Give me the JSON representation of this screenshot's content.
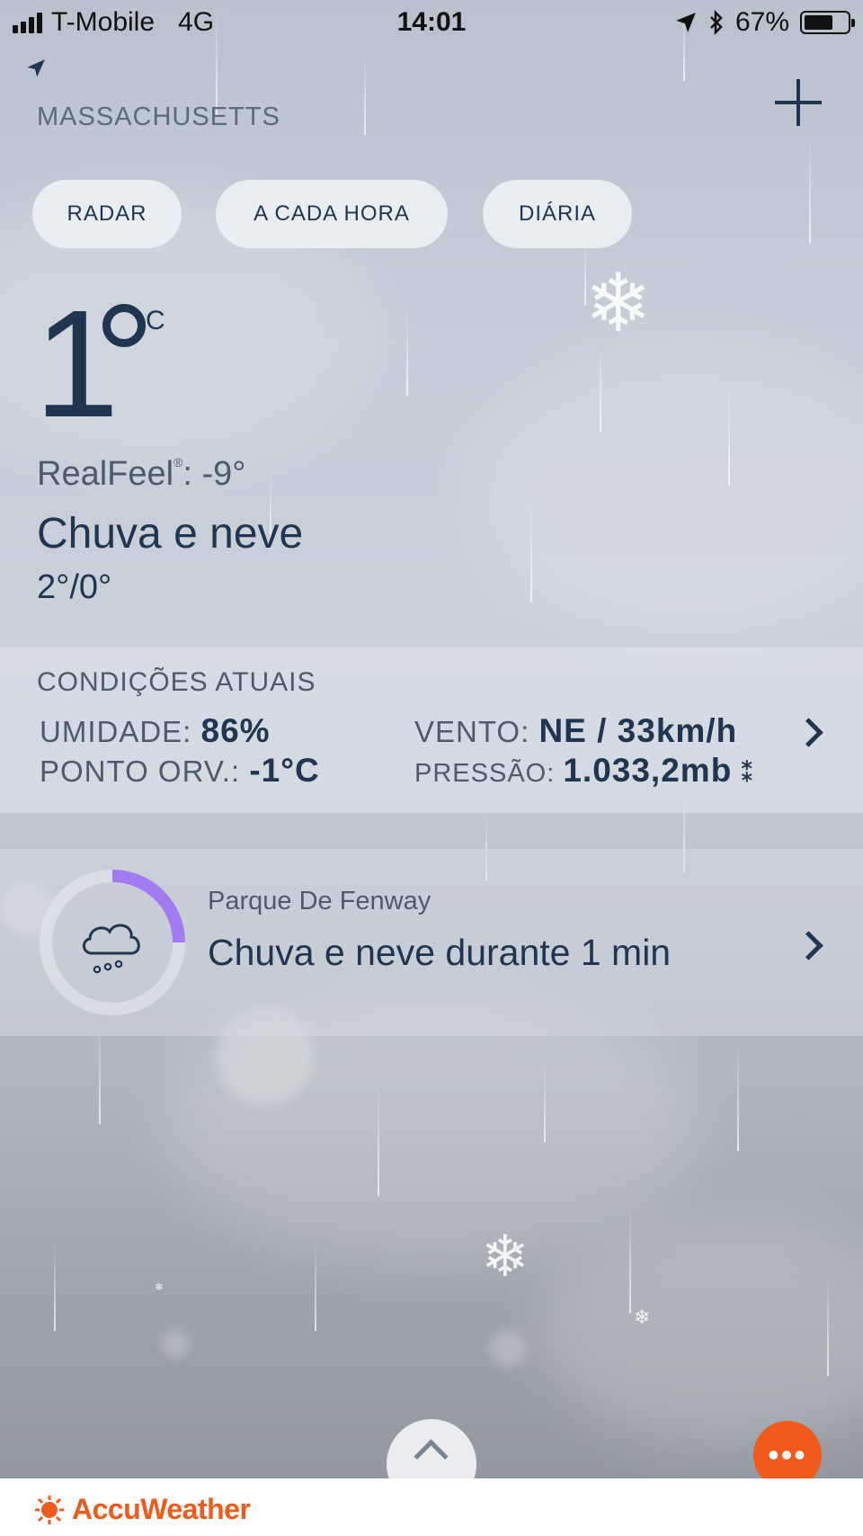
{
  "status_bar": {
    "carrier": "T-Mobile",
    "network": "4G",
    "time": "14:01",
    "battery_percent": "67%",
    "battery_level": 0.67
  },
  "header": {
    "region": "MASSACHUSETTS",
    "add_icon": "plus-icon",
    "location_icon": "location-arrow-icon"
  },
  "tabs": [
    {
      "label": "RADAR"
    },
    {
      "label": "A CADA HORA"
    },
    {
      "label": "DIÁRIA"
    }
  ],
  "current": {
    "temperature": "1",
    "unit": "C",
    "realfeel_label": "RealFeel",
    "realfeel_mark": "®",
    "realfeel_value": ": -9°",
    "condition": "Chuva e neve",
    "hi_lo": "2°/0°"
  },
  "conditions": {
    "title": "CONDIÇÕES ATUAIS",
    "humidity_label": "UMIDADE:",
    "humidity_value": "86%",
    "dew_label": "PONTO ORV.:",
    "dew_value": "-1°C",
    "wind_label": "VENTO:",
    "wind_value": "NE / 33km/h",
    "pressure_label": "PRESSÃO:",
    "pressure_value": "1.033,2mb",
    "pressure_trend_symbol": "⁑"
  },
  "minutecast": {
    "location": "Parque De Fenway",
    "text": "Chuva e neve durante 1 min",
    "progress_fraction": 0.25,
    "ring_color": "#a27bf0",
    "icon": "cloud-snow-icon"
  },
  "brand": {
    "name": "AccuWeather",
    "color": "#f05a1a"
  },
  "more_button_symbol": "•••"
}
